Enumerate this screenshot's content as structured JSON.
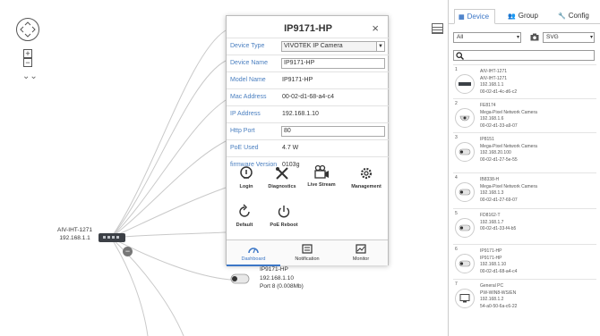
{
  "canvas": {
    "root": {
      "name": "AIV-IHT-1271",
      "ip": "192.168.1.1"
    },
    "node": {
      "name": "IP9171-HP",
      "ip": "192.168.1.10",
      "port": "Port 8 (0.008Mb)"
    }
  },
  "popup": {
    "title": "IP9171-HP",
    "close": "×",
    "rows": [
      {
        "label": "Device Type",
        "value": "VIVOTEK IP Camera"
      },
      {
        "label": "Device Name",
        "value": "IP9171-HP"
      },
      {
        "label": "Model Name",
        "value": "IP9171-HP"
      },
      {
        "label": "Mac Address",
        "value": "00-02-d1-68-a4-c4"
      },
      {
        "label": "IP Address",
        "value": "192.168.1.10"
      },
      {
        "label": "Http Port",
        "value": "80"
      },
      {
        "label": "PoE Used",
        "value": "4.7 W"
      },
      {
        "label": "firmware Version",
        "value": "0103g"
      }
    ],
    "actions": [
      "Login",
      "Diagnostics",
      "Live Stream",
      "Management",
      "Default",
      "PoE Reboot"
    ],
    "tabs": [
      "Dashboard",
      "Notification",
      "Monitor"
    ]
  },
  "panel": {
    "tabs": [
      "Device",
      "Group",
      "Config"
    ],
    "filter": "All",
    "export": "SVG",
    "devices": [
      {
        "num": "1",
        "lines": [
          "AIV-IHT-1271",
          "AIV-IHT-1271",
          "192.168.1.1",
          "00-02-d1-4c-d6-c2"
        ]
      },
      {
        "num": "2",
        "lines": [
          "FE8174",
          "Mega-Pixel Network Camera",
          "192.168.1.6",
          "00-02-d1-33-a9-07"
        ]
      },
      {
        "num": "3",
        "lines": [
          "IP8151",
          "Mega-Pixel Network Camera",
          "192.168.20.100",
          "00-02-d1-27-5e-55"
        ]
      },
      {
        "num": "4",
        "lines": [
          "IB8338-H",
          "Mega-Pixel Network Camera",
          "192.168.1.3",
          "00-02-d1-27-69-07"
        ]
      },
      {
        "num": "5",
        "lines": [
          "FD8162-T",
          "",
          "192.168.1.7",
          "00-02-d1-33-f4-b5"
        ]
      },
      {
        "num": "6",
        "lines": [
          "IP9171-HP",
          "IP9171-HP",
          "192.168.1.10",
          "00-02-d1-68-a4-c4"
        ]
      },
      {
        "num": "7",
        "lines": [
          "General PC",
          "PW-WIN8-WS/EN",
          "192.168.1.2",
          "54-a0-50-6a-c6-22"
        ]
      }
    ]
  }
}
